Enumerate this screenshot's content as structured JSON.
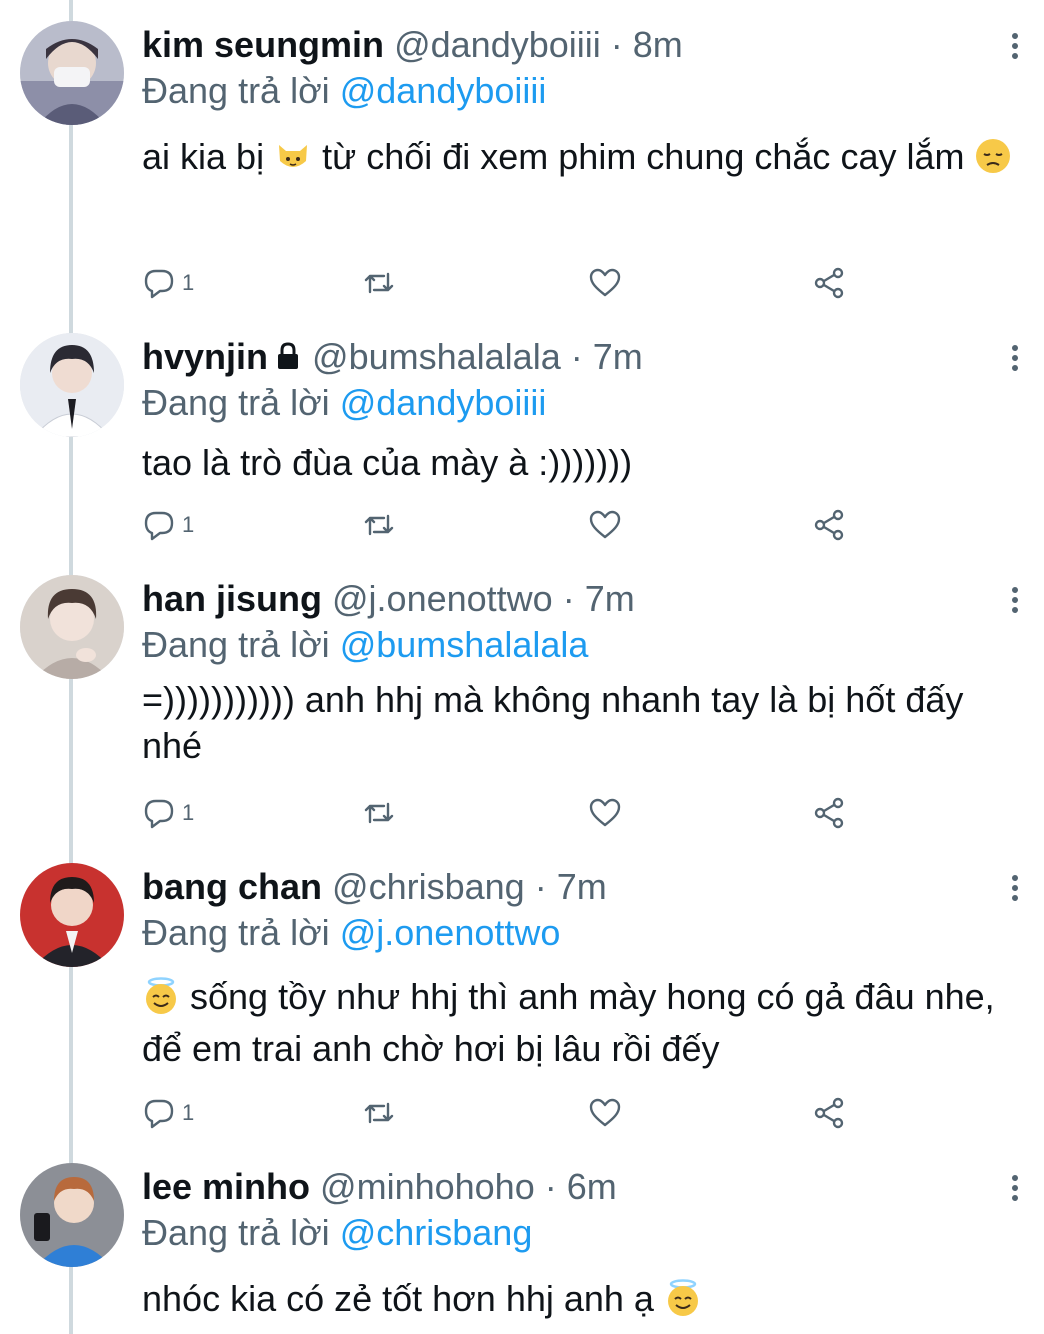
{
  "tweets": [
    {
      "name": "kim seungmin",
      "handle": "@dandyboiiii",
      "dot": "·",
      "time": "8m",
      "replying_prefix": "Đang trả lời",
      "replying_to": "@dandyboiiii",
      "text_a": "ai kia bị",
      "text_b": " từ chối đi xem phim chung chắc cay lắm ",
      "emojis": [
        "cat-face-emoji",
        "disappointed-face-emoji"
      ],
      "reply_count": "1",
      "locked": false
    },
    {
      "name": "hvynjin",
      "handle": "@bumshalalala",
      "dot": "·",
      "time": "7m",
      "replying_prefix": "Đang trả lời",
      "replying_to": "@dandyboiiii",
      "text": "tao là trò đùa của mày à :)))))))",
      "reply_count": "1",
      "locked": true
    },
    {
      "name": "han jisung",
      "handle": "@j.onenottwo",
      "dot": "·",
      "time": "7m",
      "replying_prefix": "Đang trả lời",
      "replying_to": "@bumshalalala",
      "text": "=))))))))))) anh hhj mà không nhanh tay là bị hốt đấy nhé",
      "reply_count": "1",
      "locked": false
    },
    {
      "name": "bang chan",
      "handle": "@chrisbang",
      "dot": "·",
      "time": "7m",
      "replying_prefix": "Đang trả lời",
      "replying_to": "@j.onenottwo",
      "text": " sống tồy như hhj thì anh mày hong có gả đâu nhe, để em trai anh chờ hơi bị lâu rồi đếy",
      "emojis": [
        "smiling-face-with-halo-emoji"
      ],
      "reply_count": "1",
      "locked": false
    },
    {
      "name": "lee minho",
      "handle": "@minhohoho",
      "dot": "·",
      "time": "6m",
      "replying_prefix": "Đang trả lời",
      "replying_to": "@chrisbang",
      "text": "nhóc kia có zẻ tốt hơn hhj anh ạ ",
      "emojis": [
        "smiling-face-with-halo-emoji"
      ],
      "locked": false
    }
  ],
  "colors": {
    "accent": "#1d9bf0",
    "secondary_text": "#536471",
    "primary_text": "#0f1419",
    "thread_line": "#cfd9de"
  },
  "icons": [
    "reply-icon",
    "retweet-icon",
    "like-icon",
    "share-icon",
    "more-options-icon",
    "lock-icon"
  ]
}
